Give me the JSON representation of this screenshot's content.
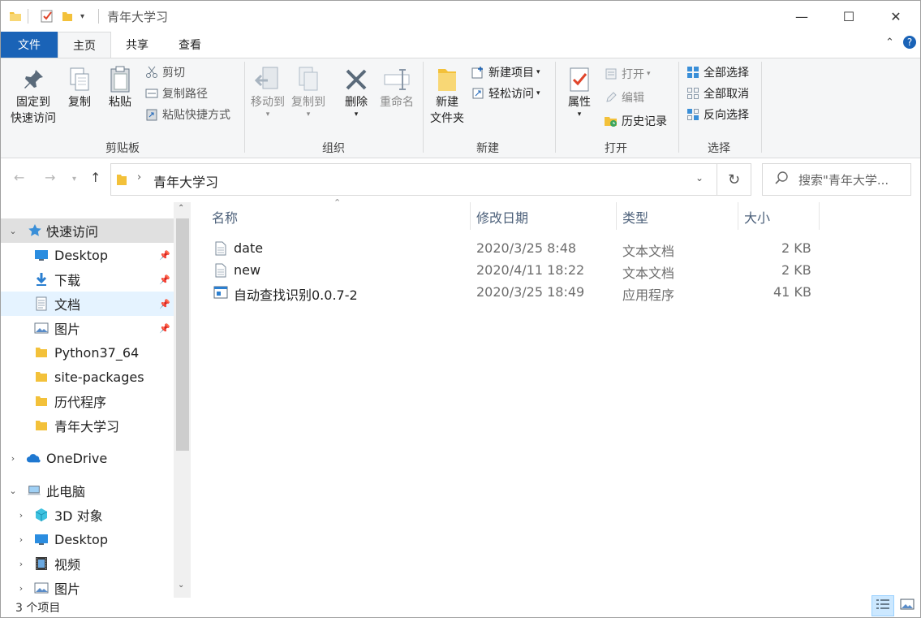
{
  "window": {
    "title": "青年大学习",
    "controls": {
      "minimize": "—",
      "maximize": "☐",
      "close": "✕"
    }
  },
  "tabs": [
    {
      "label": "文件"
    },
    {
      "label": "主页"
    },
    {
      "label": "共享"
    },
    {
      "label": "查看"
    }
  ],
  "ribbon": {
    "clipboard": {
      "group": "剪贴板",
      "pin_line1": "固定到",
      "pin_line2": "快速访问",
      "copy": "复制",
      "paste": "粘贴",
      "cut": "剪切",
      "copy_path": "复制路径",
      "paste_shortcut": "粘贴快捷方式"
    },
    "organize": {
      "group": "组织",
      "move_to": "移动到",
      "copy_to": "复制到",
      "delete": "删除",
      "rename": "重命名"
    },
    "new": {
      "group": "新建",
      "new_folder_line1": "新建",
      "new_folder_line2": "文件夹",
      "new_item": "新建项目",
      "easy_access": "轻松访问"
    },
    "open": {
      "group": "打开",
      "properties": "属性",
      "open": "打开",
      "edit": "编辑",
      "history": "历史记录"
    },
    "select": {
      "group": "选择",
      "select_all": "全部选择",
      "select_none": "全部取消",
      "invert": "反向选择"
    }
  },
  "address": {
    "path": "青年大学习",
    "search_placeholder": "搜索\"青年大学..."
  },
  "nav": {
    "quick_access": "快速访问",
    "items": [
      {
        "label": "Desktop",
        "icon": "desktop-icon",
        "pinned": true
      },
      {
        "label": "下载",
        "icon": "download-icon",
        "pinned": true
      },
      {
        "label": "文档",
        "icon": "document-icon",
        "pinned": true
      },
      {
        "label": "图片",
        "icon": "picture-icon",
        "pinned": true
      },
      {
        "label": "Python37_64",
        "icon": "folder-icon",
        "pinned": false
      },
      {
        "label": "site-packages",
        "icon": "folder-icon",
        "pinned": false
      },
      {
        "label": "历代程序",
        "icon": "folder-icon",
        "pinned": false
      },
      {
        "label": "青年大学习",
        "icon": "folder-icon",
        "pinned": false
      }
    ],
    "onedrive": "OneDrive",
    "this_pc": "此电脑",
    "pc_items": [
      {
        "label": "3D 对象",
        "icon": "3d-objects-icon"
      },
      {
        "label": "Desktop",
        "icon": "desktop-icon"
      },
      {
        "label": "视频",
        "icon": "video-icon"
      },
      {
        "label": "图片",
        "icon": "picture-icon"
      }
    ]
  },
  "columns": {
    "name": "名称",
    "date": "修改日期",
    "type": "类型",
    "size": "大小"
  },
  "files": [
    {
      "name": "date",
      "date": "2020/3/25 8:48",
      "type": "文本文档",
      "size": "2 KB",
      "icon": "text-file-icon"
    },
    {
      "name": "new",
      "date": "2020/4/11 18:22",
      "type": "文本文档",
      "size": "2 KB",
      "icon": "text-file-icon"
    },
    {
      "name": "自动查找识别0.0.7-2",
      "date": "2020/3/25 18:49",
      "type": "应用程序",
      "size": "41 KB",
      "icon": "application-icon"
    }
  ],
  "status": {
    "count": "3 个项目"
  },
  "colors": {
    "accent": "#1a63b7",
    "folder": "#f3c13a",
    "selected": "#e5f3ff"
  }
}
